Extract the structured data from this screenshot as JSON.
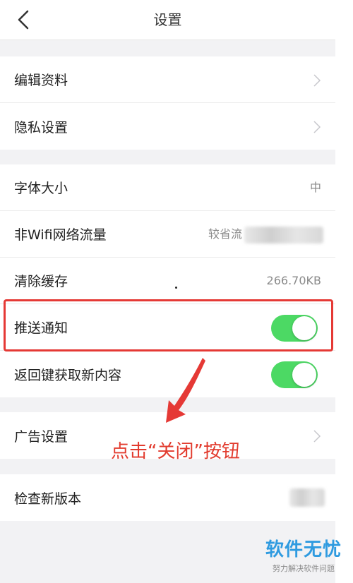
{
  "header": {
    "title": "设置"
  },
  "groups": {
    "profile": {
      "edit_profile": "编辑资料",
      "privacy": "隐私设置"
    },
    "general": {
      "font_size": {
        "label": "字体大小",
        "value": "中"
      },
      "non_wifi": {
        "label": "非Wifi网络流量",
        "value": "较省流"
      },
      "clear_cache": {
        "label": "清除缓存",
        "value": "266.70KB"
      },
      "push": {
        "label": "推送通知",
        "enabled": true
      },
      "back_refresh": {
        "label": "返回键获取新内容",
        "enabled": true
      }
    },
    "ads": {
      "ad_settings": "广告设置"
    },
    "version": {
      "check_update": "检查新版本"
    }
  },
  "annotation": "点击“关闭”按钮",
  "watermark": {
    "title": "软件无忧",
    "subtitle": "努力解决软件问题"
  },
  "colors": {
    "toggle_on": "#4cd964",
    "highlight": "#e53935",
    "annotation": "#e23b2e",
    "watermark": "#2f9be0"
  }
}
